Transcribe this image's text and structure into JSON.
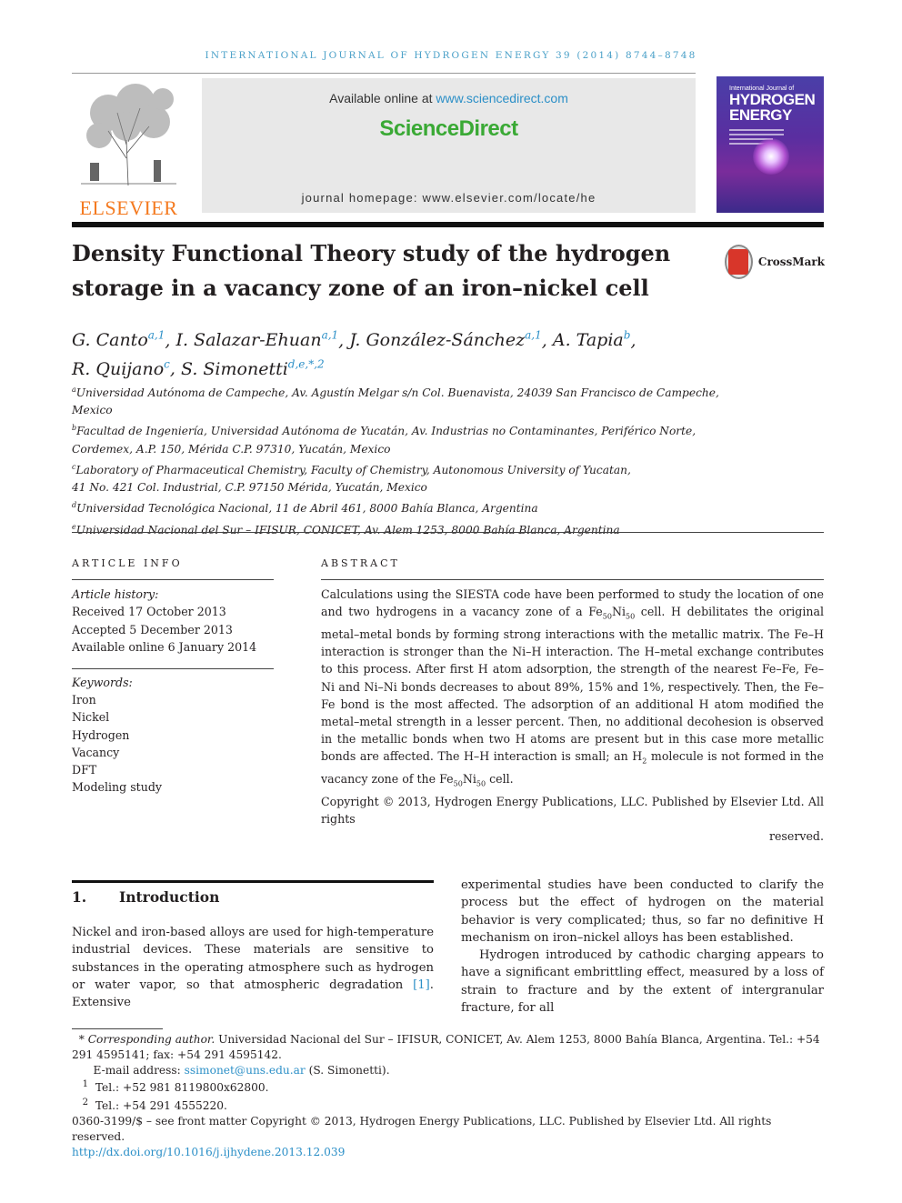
{
  "running_head": "INTERNATIONAL JOURNAL OF HYDROGEN ENERGY 39 (2014) 8744–8748",
  "publisher": {
    "logo_text": "ELSEVIER"
  },
  "banner": {
    "available_prefix": "Available online at ",
    "available_link": "www.sciencedirect.com",
    "brand": "ScienceDirect",
    "homepage": "journal homepage: www.elsevier.com/locate/he"
  },
  "cover": {
    "line1": "International Journal of",
    "line2": "HYDROGEN",
    "line3": "ENERGY"
  },
  "crossmark_label": "CrossMark",
  "title": "Density Functional Theory study of the hydrogen storage in a vacancy zone of an iron–nickel cell",
  "authors": [
    {
      "name": "G. Canto",
      "sup": "a,1",
      "sep": ", "
    },
    {
      "name": "I. Salazar-Ehuan",
      "sup": "a,1",
      "sep": ", "
    },
    {
      "name": "J. González-Sánchez",
      "sup": "a,1",
      "sep": ", "
    },
    {
      "name": "A. Tapia",
      "sup": "b",
      "sep": ","
    },
    {
      "name": "R. Quijano",
      "sup": "c",
      "sep": ", "
    },
    {
      "name": "S. Simonetti",
      "sup": "d,e,*,2",
      "sep": ""
    }
  ],
  "affiliations": [
    {
      "key": "a",
      "lines": [
        "Universidad Autónoma de Campeche, Av. Agustín Melgar s/n Col. Buenavista, 24039 San Francisco de Campeche,",
        "Mexico"
      ]
    },
    {
      "key": "b",
      "lines": [
        "Facultad de Ingeniería, Universidad Autónoma de Yucatán, Av. Industrias no Contaminantes, Periférico Norte,",
        "Cordemex, A.P. 150, Mérida C.P. 97310, Yucatán, Mexico"
      ]
    },
    {
      "key": "c",
      "lines": [
        "Laboratory of Pharmaceutical Chemistry, Faculty of Chemistry, Autonomous University of Yucatan,",
        "41 No. 421 Col. Industrial, C.P. 97150 Mérida, Yucatán, Mexico"
      ]
    },
    {
      "key": "d",
      "lines": [
        "Universidad Tecnológica Nacional, 11 de Abril 461, 8000 Bahía Blanca, Argentina"
      ]
    },
    {
      "key": "e",
      "lines": [
        "Universidad Nacional del Sur – IFISUR, CONICET, Av. Alem 1253, 8000 Bahía Blanca, Argentina"
      ]
    }
  ],
  "article_info": {
    "label": "ARTICLE INFO",
    "history_label": "Article history:",
    "history": [
      "Received 17 October 2013",
      "Accepted 5 December 2013",
      "Available online 6 January 2014"
    ],
    "keywords_label": "Keywords:",
    "keywords": [
      "Iron",
      "Nickel",
      "Hydrogen",
      "Vacancy",
      "DFT",
      "Modeling study"
    ]
  },
  "abstract": {
    "label": "ABSTRACT",
    "p1_a": "Calculations using the SIESTA code have been performed to study the location of one and two hydrogens in a vacancy zone of a Fe",
    "sub1": "50",
    "p1_b": "Ni",
    "sub2": "50",
    "p1_c": " cell. H debilitates the original metal–metal bonds by forming strong interactions with the metallic matrix. The Fe–H interaction is stronger than the Ni–H interaction. The H–metal exchange contributes to this process. After first H atom adsorption, the strength of the nearest Fe–Fe, Fe–Ni and Ni–Ni bonds decreases to about 89%, 15% and 1%, respectively. Then, the Fe–Fe bond is the most affected. The adsorption of an additional H atom modified the metal–metal strength in a lesser percent. Then, no additional decohesion is observed in the metallic bonds when two H atoms are present but in this case more metallic bonds are affected. The H–H interaction is small; an H",
    "sub3": "2",
    "p1_d": " molecule is not formed in the vacancy zone of the Fe",
    "sub4": "50",
    "p1_e": "Ni",
    "sub5": "50",
    "p1_f": " cell.",
    "copyright": "Copyright © 2013, Hydrogen Energy Publications, LLC. Published by Elsevier Ltd. All rights",
    "copyright_end": "reserved."
  },
  "intro": {
    "number": "1.",
    "heading": "Introduction",
    "col1_a": "Nickel and iron-based alloys are used for high-temperature industrial devices. These materials are sensitive to substances in the operating atmosphere such as hydrogen or water vapor, so that atmospheric degradation ",
    "col1_ref": "[1]",
    "col1_b": ". Extensive",
    "col2_p1": "experimental studies have been conducted to clarify the process but the effect of hydrogen on the material behavior is very complicated; thus, so far no definitive H mechanism on iron–nickel alloys has been established.",
    "col2_p2": "Hydrogen introduced by cathodic charging appears to have a significant embrittling effect, measured by a loss of strain to fracture and by the extent of intergranular fracture, for all"
  },
  "footnotes": {
    "corr_mark": "*",
    "corr_label": "Corresponding author.",
    "corr_text": " Universidad Nacional del Sur – IFISUR, CONICET, Av. Alem 1253, 8000 Bahía Blanca, Argentina. Tel.: +54 291 4595141; fax: +54 291 4595142.",
    "email_label": "E-mail address: ",
    "email": "ssimonet@uns.edu.ar",
    "email_who": " (S. Simonetti).",
    "fn1_mark": "1",
    "fn1": "Tel.: +52 981 8119800x62800.",
    "fn2_mark": "2",
    "fn2": "Tel.: +54 291 4555220.",
    "issn_line": "0360-3199/$ – see front matter Copyright © 2013, Hydrogen Energy Publications, LLC. Published by Elsevier Ltd. All rights reserved.",
    "doi": "http://dx.doi.org/10.1016/j.ijhydene.2013.12.039"
  }
}
